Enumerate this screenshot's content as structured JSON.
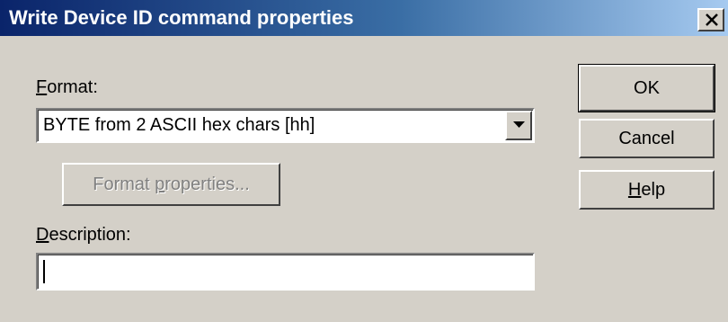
{
  "window": {
    "title": "Write Device ID command properties"
  },
  "format": {
    "label_accel": "F",
    "label_rest": "ormat:",
    "selected_value": "BYTE from 2 ASCII hex chars  [hh]"
  },
  "format_properties_button": {
    "label_pre": "Format ",
    "label_accel": "p",
    "label_rest": "roperties..."
  },
  "description": {
    "label_accel": "D",
    "label_rest": "escription:",
    "value": ""
  },
  "buttons": {
    "ok": "OK",
    "cancel": "Cancel",
    "help_accel": "H",
    "help_rest": "elp"
  },
  "icons": {
    "close": "close-icon",
    "dropdown": "chevron-down-icon"
  }
}
